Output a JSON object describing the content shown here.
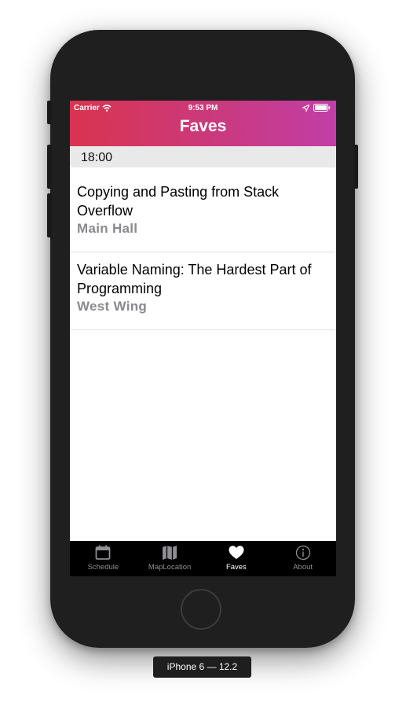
{
  "status_bar": {
    "carrier": "Carrier",
    "time": "9:53 PM"
  },
  "nav": {
    "title": "Faves",
    "gradient_start": "#d9344f",
    "gradient_end": "#c23ea7"
  },
  "section": {
    "time": "18:00"
  },
  "sessions": [
    {
      "title": "Copying and Pasting from Stack Overflow",
      "location": "Main Hall"
    },
    {
      "title": "Variable Naming: The Hardest Part of Programming",
      "location": "West Wing"
    }
  ],
  "tabs": [
    {
      "label": "Schedule",
      "icon": "calendar-icon",
      "active": false
    },
    {
      "label": "MapLocation",
      "icon": "map-icon",
      "active": false
    },
    {
      "label": "Faves",
      "icon": "heart-icon",
      "active": true
    },
    {
      "label": "About",
      "icon": "info-icon",
      "active": false
    }
  ],
  "device_label": "iPhone 6 — 12.2"
}
